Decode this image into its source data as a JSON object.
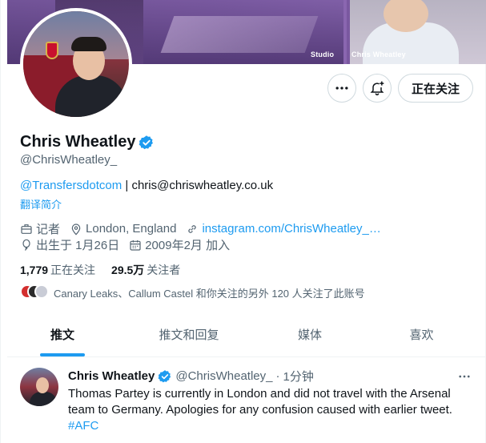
{
  "banner": {
    "studio_tag": "Studio",
    "name_tag": "Chris Wheatley"
  },
  "actions": {
    "more_icon": "more-icon",
    "notify_icon": "bell-plus-icon",
    "follow_label": "正在关注"
  },
  "profile": {
    "display_name": "Chris Wheatley",
    "handle": "@ChrisWheatley_",
    "bio_mention": "@Transfersdotcom",
    "bio_rest": " | chris@chriswheatley.co.uk",
    "translate": "翻译简介",
    "job": "记者",
    "location": "London, England",
    "website": "instagram.com/ChrisWheatley_…",
    "birthday": "出生于 1月26日",
    "joined": "2009年2月 加入"
  },
  "stats": {
    "following_count": "1,779",
    "following_label": "正在关注",
    "followers_count": "29.5万",
    "followers_label": "关注者"
  },
  "followed_by": "Canary Leaks、Callum Castel 和你关注的另外 120 人关注了此账号",
  "tabs": [
    {
      "label": "推文",
      "active": true
    },
    {
      "label": "推文和回复",
      "active": false
    },
    {
      "label": "媒体",
      "active": false
    },
    {
      "label": "喜欢",
      "active": false
    }
  ],
  "tweet": {
    "name": "Chris Wheatley",
    "handle": "@ChrisWheatley_",
    "separator": "·",
    "time": "1分钟",
    "text": "Thomas Partey is currently in London and did not travel with the Arsenal team to Germany. Apologies for any confusion caused with earlier tweet.",
    "hashtag": "#AFC"
  },
  "colors": {
    "accent": "#1d9bf0",
    "text_primary": "#0f1419",
    "text_secondary": "#536471",
    "border": "#cfd9de"
  }
}
